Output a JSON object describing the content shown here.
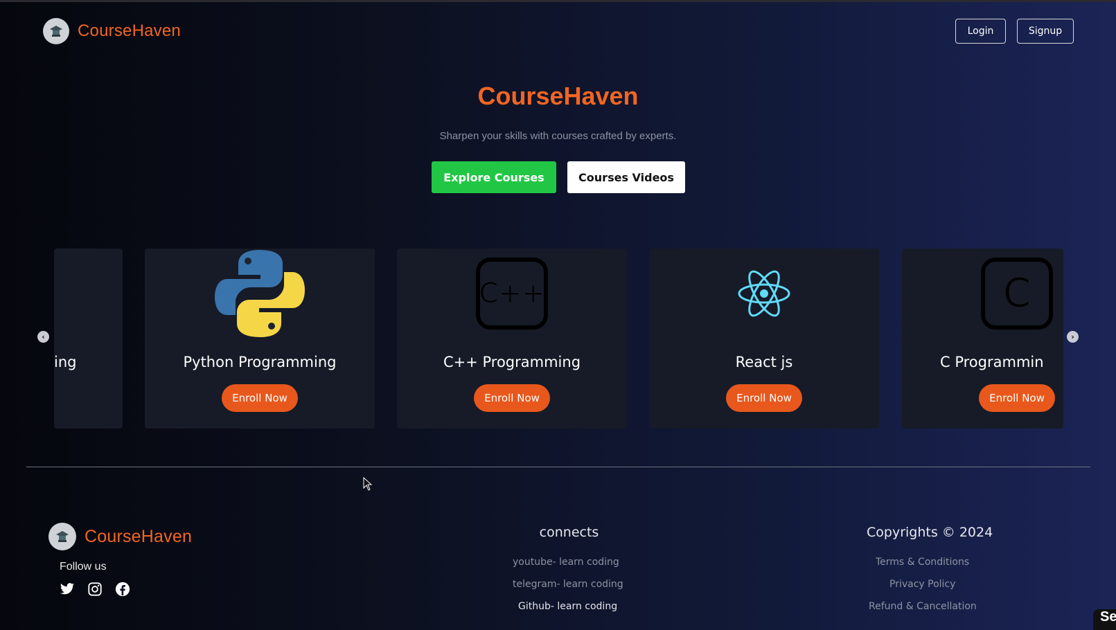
{
  "header": {
    "brand": "CourseHaven",
    "login_label": "Login",
    "signup_label": "Signup"
  },
  "hero": {
    "title": "CourseHaven",
    "subtitle": "Sharpen your skills with courses crafted by experts.",
    "explore_label": "Explore Courses",
    "videos_label": "Courses Videos"
  },
  "courses": [
    {
      "title": "ing",
      "enroll": "",
      "icon": "none"
    },
    {
      "title": "Python Programming",
      "enroll": "Enroll Now",
      "icon": "python-logo-icon"
    },
    {
      "title": "C++ Programming",
      "enroll": "Enroll Now",
      "icon": "cpp-logo-icon"
    },
    {
      "title": "React js",
      "enroll": "Enroll Now",
      "icon": "react-logo-icon"
    },
    {
      "title": "C Programmin",
      "enroll": "Enroll Now",
      "icon": "c-logo-icon"
    }
  ],
  "carousel": {
    "prev_icon": "chevron-left-icon",
    "next_icon": "chevron-right-icon"
  },
  "footer": {
    "brand": "CourseHaven",
    "follow_label": "Follow us",
    "social_icons": [
      "twitter-icon",
      "instagram-icon",
      "facebook-icon"
    ],
    "connects_heading": "connects",
    "connects_links": [
      "youtube- learn coding",
      "telegram- learn coding",
      "Github- learn coding"
    ],
    "copyright_heading": "Copyrights © 2024",
    "legal_links": [
      "Terms & Conditions",
      "Privacy Policy",
      "Refund & Cancellation"
    ]
  },
  "corner_text": "Se",
  "colors": {
    "brand_orange": "#f26522",
    "enroll_orange": "#e8581c",
    "explore_green": "#21c744",
    "card_bg": "#161b27"
  }
}
